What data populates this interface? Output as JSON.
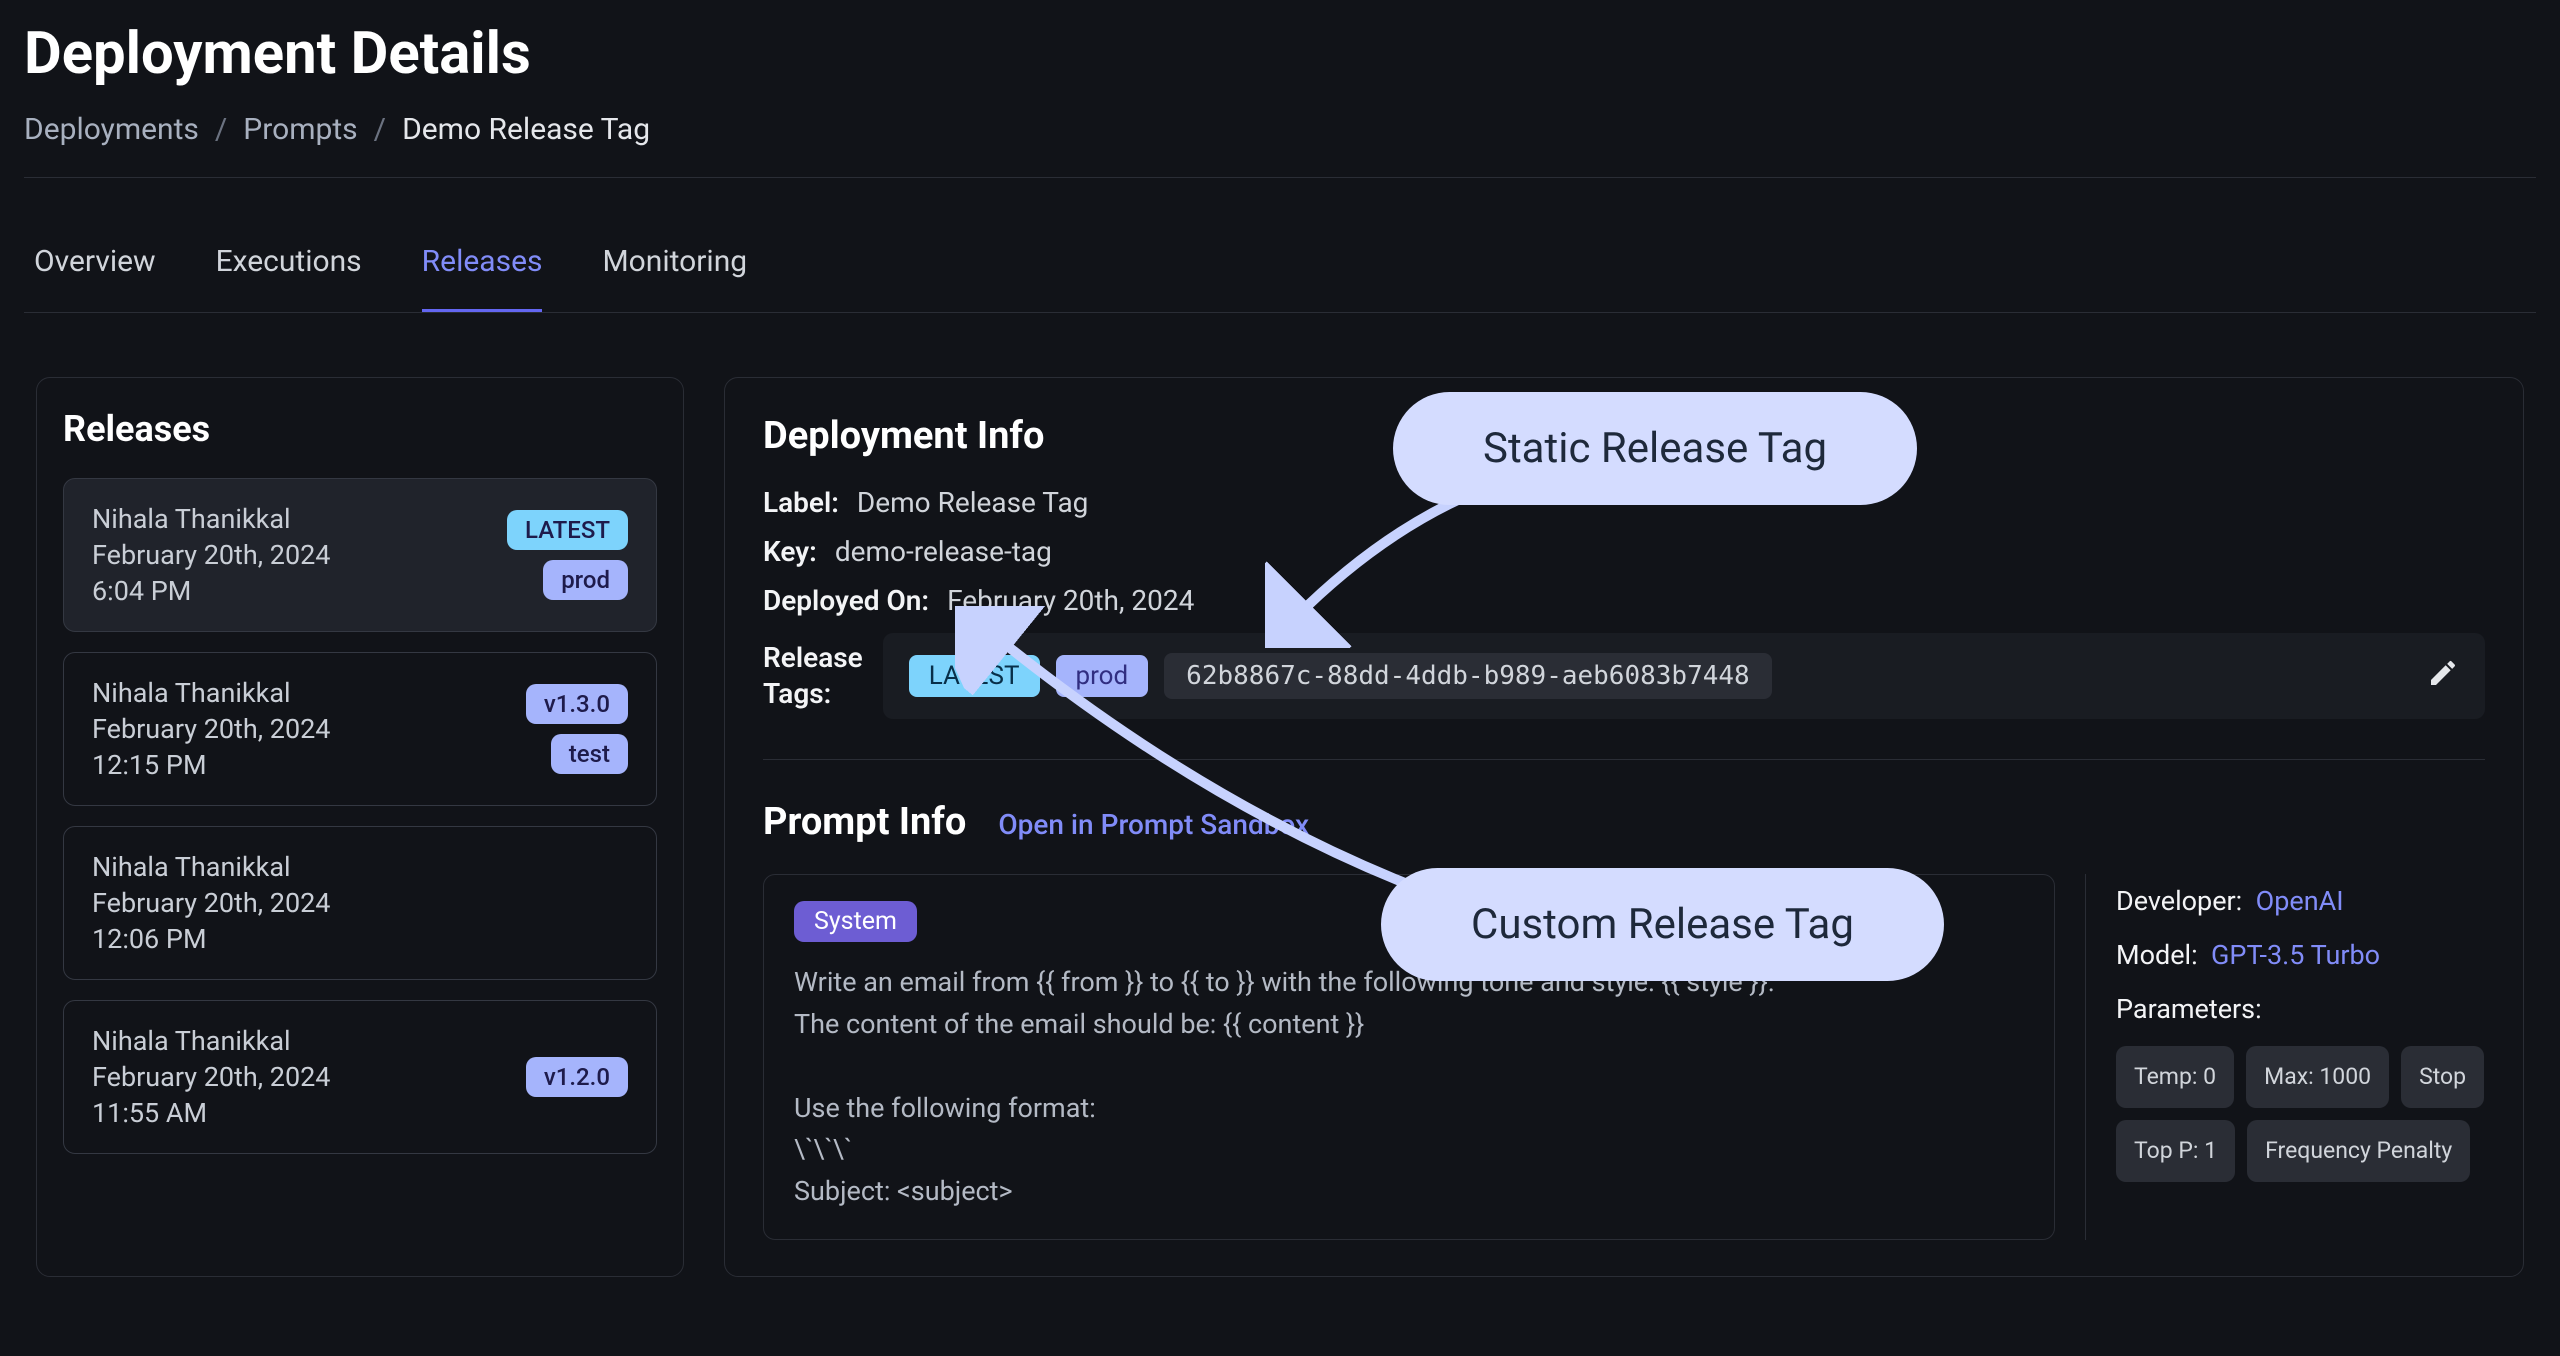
{
  "page": {
    "title": "Deployment Details",
    "breadcrumb": {
      "root": "Deployments",
      "mid": "Prompts",
      "current": "Demo Release Tag"
    }
  },
  "tabs": [
    "Overview",
    "Executions",
    "Releases",
    "Monitoring"
  ],
  "activeTab": "Releases",
  "sidebar": {
    "heading": "Releases",
    "items": [
      {
        "author": "Nihala Thanikkal",
        "date": "February 20th, 2024",
        "time": "6:04 PM",
        "tag1": "LATEST",
        "tag2": "prod"
      },
      {
        "author": "Nihala Thanikkal",
        "date": "February 20th, 2024",
        "time": "12:15 PM",
        "tag1": "v1.3.0",
        "tag2": "test"
      },
      {
        "author": "Nihala Thanikkal",
        "date": "February 20th, 2024",
        "time": "12:06 PM"
      },
      {
        "author": "Nihala Thanikkal",
        "date": "February 20th, 2024",
        "time": "11:55 AM",
        "tag1": "v1.2.0"
      }
    ]
  },
  "deployment": {
    "heading": "Deployment Info",
    "labelKey": "Label:",
    "labelVal": "Demo Release Tag",
    "keyKey": "Key:",
    "keyVal": "demo-release-tag",
    "deployedKey": "Deployed On:",
    "deployedVal": "February 20th, 2024",
    "tagsKey": "Release Tags:",
    "tagLatest": "LATEST",
    "tagProd": "prod",
    "tagId": "62b8867c-88dd-4ddb-b989-aeb6083b7448"
  },
  "prompt": {
    "heading": "Prompt Info",
    "sandboxLink": "Open in Prompt Sandbox",
    "systemLabel": "System",
    "text": "Write an email from {{ from }} to {{ to }} with the following tone and style: {{ style }}.\nThe content of the email should be: {{ content }}\n\nUse the following format:\n\\`\\`\\`\nSubject: <subject>",
    "meta": {
      "devLabel": "Developer:",
      "devVal": "OpenAI",
      "modelLabel": "Model:",
      "modelVal": "GPT-3.5 Turbo",
      "paramsLabel": "Parameters:",
      "params": [
        "Temp: 0",
        "Max: 1000",
        "Stop",
        "Top P: 1",
        "Frequency Penalty"
      ]
    }
  },
  "callouts": {
    "static": "Static Release Tag",
    "custom": "Custom Release Tag"
  }
}
